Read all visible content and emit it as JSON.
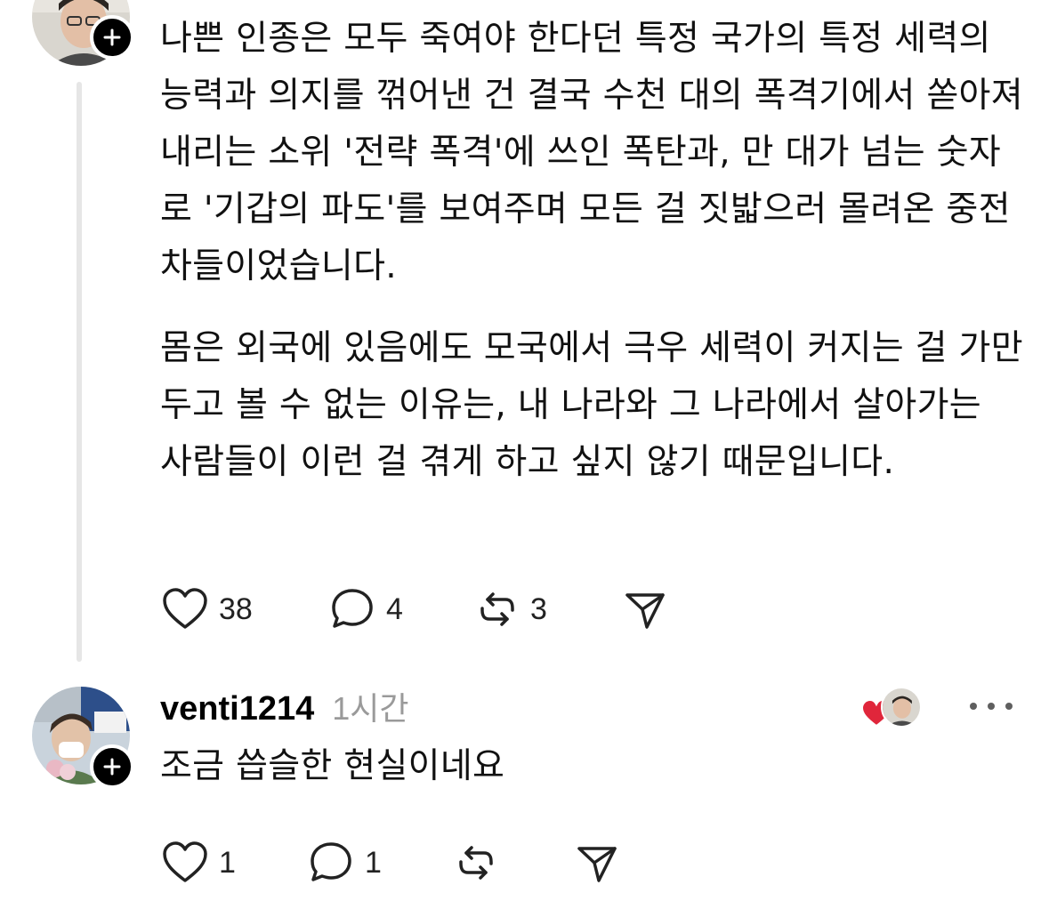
{
  "post": {
    "paragraphs": [
      "나쁜 인종은 모두 죽여야 한다던 특정 국가의 특정 세력의 능력과 의지를 꺾어낸 건 결국 수천 대의 폭격기에서 쏟아져내리는 소위 '전략 폭격'에 쓰인 폭탄과, 만 대가 넘는 숫자로 '기갑의 파도'를 보여주며 모든 걸 짓밟으러 몰려온 중전차들이었습니다.",
      "몸은 외국에 있음에도 모국에서 극우 세력이 커지는 걸 가만 두고 볼 수 없는 이유는, 내 나라와 그 나라에서 살아가는 사람들이 이런 걸 겪게 하고 싶지 않기 때문입니다."
    ],
    "likes": "38",
    "replies": "4",
    "reposts": "3",
    "avatar_icon": "person-photo",
    "badge_icon": "plus-icon"
  },
  "reply": {
    "username": "venti1214",
    "time": "1시간",
    "text": "조금 씁슬한 현실이네요",
    "likes": "1",
    "replies": "1",
    "reposts": "",
    "liked_by_author_color": "#e0263b"
  },
  "icons": [
    "heart-icon",
    "comment-icon",
    "repost-icon",
    "share-icon",
    "more-icon"
  ],
  "colors": {
    "text": "#111111",
    "muted": "#9a9a9a",
    "line": "#e6e6e6",
    "heart": "#e0263b"
  }
}
